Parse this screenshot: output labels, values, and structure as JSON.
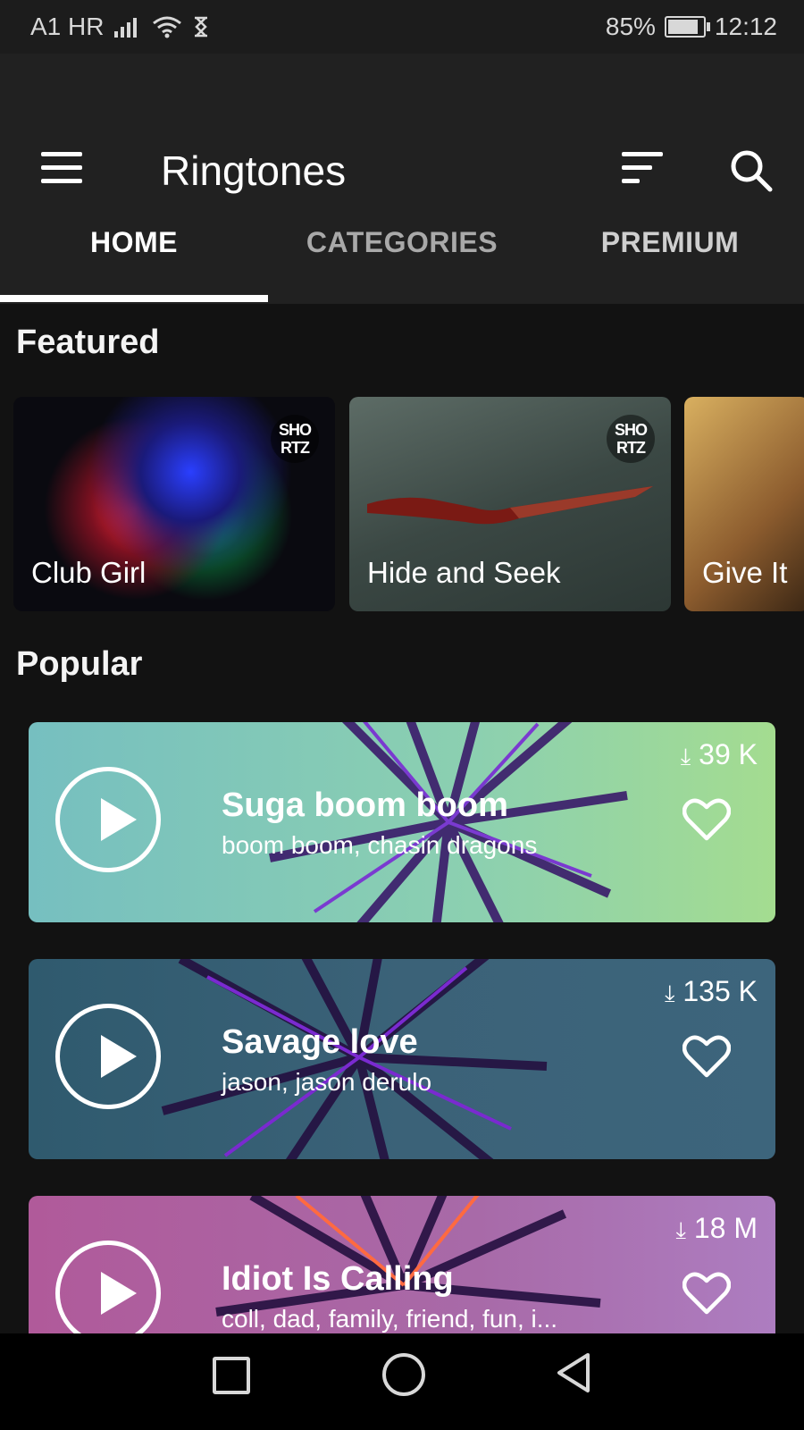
{
  "status_bar": {
    "carrier": "A1 HR",
    "battery": "85%",
    "battery_level": 0.85,
    "time": "12:12",
    "icons": [
      "signal-icon",
      "wifi-icon",
      "hourglass-icon",
      "battery-icon"
    ]
  },
  "app_bar": {
    "title": "Ringtones",
    "icons": [
      "menu-icon",
      "sort-icon",
      "search-icon"
    ]
  },
  "tabs": [
    {
      "label": "HOME",
      "active": true
    },
    {
      "label": "CATEGORIES",
      "active": false
    },
    {
      "label": "PREMIUM",
      "active": false
    }
  ],
  "featured": {
    "title": "Featured",
    "items": [
      {
        "label": "Club Girl",
        "badge": "SHO RTZ"
      },
      {
        "label": "Hide and Seek",
        "badge": "SHO RTZ"
      },
      {
        "label": "Give It"
      }
    ]
  },
  "popular": {
    "title": "Popular",
    "items": [
      {
        "name": "Suga boom boom",
        "tags": "boom boom, chasin dragons",
        "downloads": "39 K",
        "color": "#8cd0b0"
      },
      {
        "name": "Savage love",
        "tags": "jason, jason derulo",
        "downloads": "135 K",
        "color": "#3b6278"
      },
      {
        "name": "Idiot Is Calling",
        "tags": "coll, dad, family, friend, fun, i...",
        "downloads": "18 M",
        "color": "#a86aa8"
      }
    ]
  },
  "nav_bar": {
    "icons": [
      "recents-square-icon",
      "home-circle-icon",
      "back-triangle-icon"
    ]
  }
}
